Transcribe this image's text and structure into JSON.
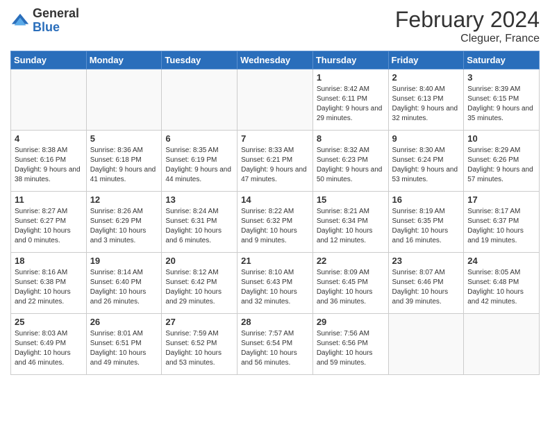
{
  "header": {
    "logo_general": "General",
    "logo_blue": "Blue",
    "title": "February 2024",
    "subtitle": "Cleguer, France"
  },
  "days_of_week": [
    "Sunday",
    "Monday",
    "Tuesday",
    "Wednesday",
    "Thursday",
    "Friday",
    "Saturday"
  ],
  "weeks": [
    [
      {
        "day": "",
        "info": ""
      },
      {
        "day": "",
        "info": ""
      },
      {
        "day": "",
        "info": ""
      },
      {
        "day": "",
        "info": ""
      },
      {
        "day": "1",
        "info": "Sunrise: 8:42 AM\nSunset: 6:11 PM\nDaylight: 9 hours and 29 minutes."
      },
      {
        "day": "2",
        "info": "Sunrise: 8:40 AM\nSunset: 6:13 PM\nDaylight: 9 hours and 32 minutes."
      },
      {
        "day": "3",
        "info": "Sunrise: 8:39 AM\nSunset: 6:15 PM\nDaylight: 9 hours and 35 minutes."
      }
    ],
    [
      {
        "day": "4",
        "info": "Sunrise: 8:38 AM\nSunset: 6:16 PM\nDaylight: 9 hours and 38 minutes."
      },
      {
        "day": "5",
        "info": "Sunrise: 8:36 AM\nSunset: 6:18 PM\nDaylight: 9 hours and 41 minutes."
      },
      {
        "day": "6",
        "info": "Sunrise: 8:35 AM\nSunset: 6:19 PM\nDaylight: 9 hours and 44 minutes."
      },
      {
        "day": "7",
        "info": "Sunrise: 8:33 AM\nSunset: 6:21 PM\nDaylight: 9 hours and 47 minutes."
      },
      {
        "day": "8",
        "info": "Sunrise: 8:32 AM\nSunset: 6:23 PM\nDaylight: 9 hours and 50 minutes."
      },
      {
        "day": "9",
        "info": "Sunrise: 8:30 AM\nSunset: 6:24 PM\nDaylight: 9 hours and 53 minutes."
      },
      {
        "day": "10",
        "info": "Sunrise: 8:29 AM\nSunset: 6:26 PM\nDaylight: 9 hours and 57 minutes."
      }
    ],
    [
      {
        "day": "11",
        "info": "Sunrise: 8:27 AM\nSunset: 6:27 PM\nDaylight: 10 hours and 0 minutes."
      },
      {
        "day": "12",
        "info": "Sunrise: 8:26 AM\nSunset: 6:29 PM\nDaylight: 10 hours and 3 minutes."
      },
      {
        "day": "13",
        "info": "Sunrise: 8:24 AM\nSunset: 6:31 PM\nDaylight: 10 hours and 6 minutes."
      },
      {
        "day": "14",
        "info": "Sunrise: 8:22 AM\nSunset: 6:32 PM\nDaylight: 10 hours and 9 minutes."
      },
      {
        "day": "15",
        "info": "Sunrise: 8:21 AM\nSunset: 6:34 PM\nDaylight: 10 hours and 12 minutes."
      },
      {
        "day": "16",
        "info": "Sunrise: 8:19 AM\nSunset: 6:35 PM\nDaylight: 10 hours and 16 minutes."
      },
      {
        "day": "17",
        "info": "Sunrise: 8:17 AM\nSunset: 6:37 PM\nDaylight: 10 hours and 19 minutes."
      }
    ],
    [
      {
        "day": "18",
        "info": "Sunrise: 8:16 AM\nSunset: 6:38 PM\nDaylight: 10 hours and 22 minutes."
      },
      {
        "day": "19",
        "info": "Sunrise: 8:14 AM\nSunset: 6:40 PM\nDaylight: 10 hours and 26 minutes."
      },
      {
        "day": "20",
        "info": "Sunrise: 8:12 AM\nSunset: 6:42 PM\nDaylight: 10 hours and 29 minutes."
      },
      {
        "day": "21",
        "info": "Sunrise: 8:10 AM\nSunset: 6:43 PM\nDaylight: 10 hours and 32 minutes."
      },
      {
        "day": "22",
        "info": "Sunrise: 8:09 AM\nSunset: 6:45 PM\nDaylight: 10 hours and 36 minutes."
      },
      {
        "day": "23",
        "info": "Sunrise: 8:07 AM\nSunset: 6:46 PM\nDaylight: 10 hours and 39 minutes."
      },
      {
        "day": "24",
        "info": "Sunrise: 8:05 AM\nSunset: 6:48 PM\nDaylight: 10 hours and 42 minutes."
      }
    ],
    [
      {
        "day": "25",
        "info": "Sunrise: 8:03 AM\nSunset: 6:49 PM\nDaylight: 10 hours and 46 minutes."
      },
      {
        "day": "26",
        "info": "Sunrise: 8:01 AM\nSunset: 6:51 PM\nDaylight: 10 hours and 49 minutes."
      },
      {
        "day": "27",
        "info": "Sunrise: 7:59 AM\nSunset: 6:52 PM\nDaylight: 10 hours and 53 minutes."
      },
      {
        "day": "28",
        "info": "Sunrise: 7:57 AM\nSunset: 6:54 PM\nDaylight: 10 hours and 56 minutes."
      },
      {
        "day": "29",
        "info": "Sunrise: 7:56 AM\nSunset: 6:56 PM\nDaylight: 10 hours and 59 minutes."
      },
      {
        "day": "",
        "info": ""
      },
      {
        "day": "",
        "info": ""
      }
    ]
  ]
}
